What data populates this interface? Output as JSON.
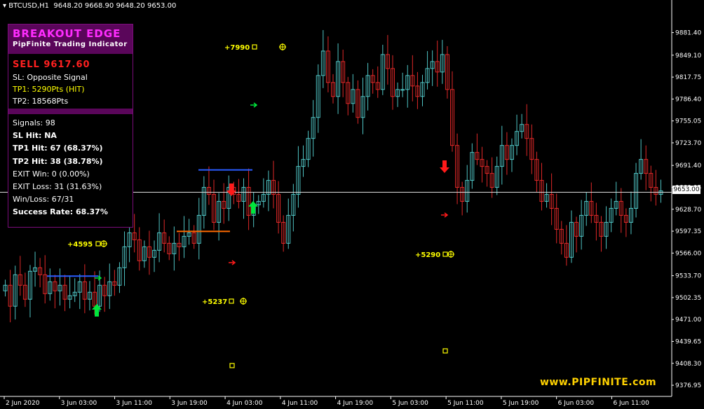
{
  "header": {
    "symbol": "BTCUSD,H1",
    "ohlc": "9648.20 9668.90 9648.20 9653.00"
  },
  "panel": {
    "title": "BREAKOUT EDGE",
    "subtitle": "PipFinite Trading Indicator",
    "signal": "SELL 9617.60",
    "sl": "SL: Opposite Signal",
    "tp1": "TP1: 5290Pts (HIT)",
    "tp2": "TP2: 18568Pts",
    "signals": "Signals: 98",
    "sl_hit": "SL Hit: NA",
    "tp1_hit": "TP1 Hit: 67 (68.37%)",
    "tp2_hit": "TP2 Hit: 38 (38.78%)",
    "exit_win": "EXIT Win: 0 (0.00%)",
    "exit_loss": "EXIT Loss: 31 (31.63%)",
    "win_loss": "Win/Loss: 67/31",
    "success_rate": "Success Rate: 68.37%"
  },
  "watermark": "www.PIPFINITE.com",
  "current_price": "9653.00",
  "chart_data": {
    "type": "candlestick",
    "title": "BTCUSD,H1",
    "ylim": [
      9361,
      9912
    ],
    "y_ticks": [
      "9881.40",
      "9849.10",
      "9817.75",
      "9786.40",
      "9755.05",
      "9723.70",
      "9691.40",
      "9660.05",
      "9628.70",
      "9597.35",
      "9566.00",
      "9533.70",
      "9502.35",
      "9471.00",
      "9439.65",
      "9408.30",
      "9376.95"
    ],
    "x_ticks": [
      "2 Jun 2020",
      "3 Jun 03:00",
      "3 Jun 11:00",
      "3 Jun 19:00",
      "4 Jun 03:00",
      "4 Jun 11:00",
      "4 Jun 19:00",
      "5 Jun 03:00",
      "5 Jun 11:00",
      "5 Jun 19:00",
      "6 Jun 03:00",
      "6 Jun 11:00"
    ],
    "current_price": 9653.0,
    "colors": {
      "bull": "#4fc3c3",
      "bear": "#e02828",
      "arrow_up": "#00e63c",
      "arrow_down": "#ff1a1a",
      "label": "#ffff00"
    },
    "candles_close": [
      9520,
      9490,
      9535,
      9520,
      9500,
      9540,
      9545,
      9535,
      9508,
      9525,
      9512,
      9520,
      9500,
      9505,
      9510,
      9525,
      9500,
      9510,
      9490,
      9520,
      9505,
      9525,
      9520,
      9545,
      9575,
      9595,
      9585,
      9555,
      9575,
      9560,
      9570,
      9595,
      9580,
      9565,
      9580,
      9575,
      9590,
      9595,
      9580,
      9620,
      9660,
      9650,
      9610,
      9640,
      9630,
      9660,
      9650,
      9640,
      9660,
      9620,
      9635,
      9640,
      9650,
      9670,
      9650,
      9610,
      9580,
      9620,
      9650,
      9690,
      9700,
      9730,
      9760,
      9820,
      9855,
      9810,
      9790,
      9840,
      9810,
      9780,
      9800,
      9760,
      9790,
      9820,
      9810,
      9800,
      9850,
      9830,
      9790,
      9800,
      9800,
      9820,
      9805,
      9790,
      9810,
      9830,
      9840,
      9825,
      9850,
      9800,
      9720,
      9660,
      9640,
      9670,
      9710,
      9700,
      9690,
      9680,
      9660,
      9690,
      9720,
      9700,
      9720,
      9740,
      9750,
      9730,
      9700,
      9670,
      9640,
      9650,
      9630,
      9600,
      9580,
      9560,
      9610,
      9590,
      9620,
      9640,
      9620,
      9610,
      9590,
      9610,
      9630,
      9640,
      9620,
      9610,
      9630,
      9680,
      9700,
      9680,
      9660,
      9650,
      9655
    ],
    "signals": [
      {
        "kind": "buy",
        "price": 9502,
        "profit_label": "+4595"
      },
      {
        "kind": "sell",
        "price": 9655,
        "profit_label": "+5237"
      },
      {
        "kind": "buy",
        "price": 9650,
        "profit_label": "+7990"
      },
      {
        "kind": "sell",
        "price": 9617.6,
        "profit_label": "+5290"
      }
    ]
  }
}
